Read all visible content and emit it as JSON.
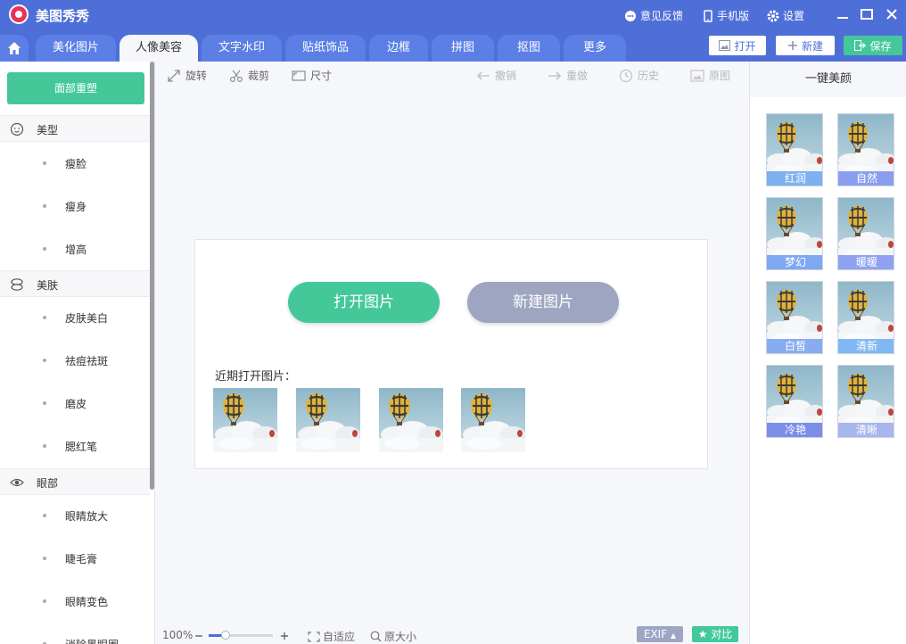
{
  "app": {
    "title": "美图秀秀",
    "feedback": "意见反馈",
    "mobile": "手机版",
    "settings": "设置"
  },
  "tabs": [
    "美化图片",
    "人像美容",
    "文字水印",
    "贴纸饰品",
    "边框",
    "拼图",
    "抠图",
    "更多"
  ],
  "active_tab": "人像美容",
  "actions": {
    "open": "打开",
    "new": "新建",
    "save": "保存"
  },
  "left_panel": {
    "face_reset": "面部重塑",
    "categories": [
      {
        "label": "美型",
        "icon": "face-icon",
        "items": [
          "瘦脸",
          "瘦身",
          "增高"
        ]
      },
      {
        "label": "美肤",
        "icon": "skin-icon",
        "items": [
          "皮肤美白",
          "祛痘祛斑",
          "磨皮",
          "腮红笔"
        ]
      },
      {
        "label": "眼部",
        "icon": "eye-icon",
        "items": [
          "眼睛放大",
          "睫毛膏",
          "眼睛变色",
          "消除黑眼圈"
        ]
      }
    ]
  },
  "toolbar": {
    "rotate": "旋转",
    "crop": "裁剪",
    "size": "尺寸",
    "undo": "撤销",
    "redo": "重做",
    "history": "历史",
    "original": "原图"
  },
  "canvas": {
    "open_image": "打开图片",
    "new_image": "新建图片",
    "recent_label": "近期打开图片："
  },
  "right_panel": {
    "title": "一键美颜",
    "presets": [
      {
        "label": "红润",
        "color": "#7fb0f0"
      },
      {
        "label": "自然",
        "color": "#8a9ef0"
      },
      {
        "label": "梦幻",
        "color": "#7ea8f2"
      },
      {
        "label": "暖暖",
        "color": "#8fa2f2"
      },
      {
        "label": "白皙",
        "color": "#88acf0"
      },
      {
        "label": "清新",
        "color": "#7fb8f2"
      },
      {
        "label": "冷艳",
        "color": "#7b8ee8"
      },
      {
        "label": "清晰",
        "color": "#a8b6ee"
      }
    ]
  },
  "statusbar": {
    "zoom": "100%",
    "fit": "自适应",
    "actual": "原大小",
    "exif": "EXIF",
    "compare": "对比"
  },
  "colors": {
    "brand": "#4f6fd8",
    "green": "#44c89a",
    "gray_button": "#9da5c0"
  }
}
